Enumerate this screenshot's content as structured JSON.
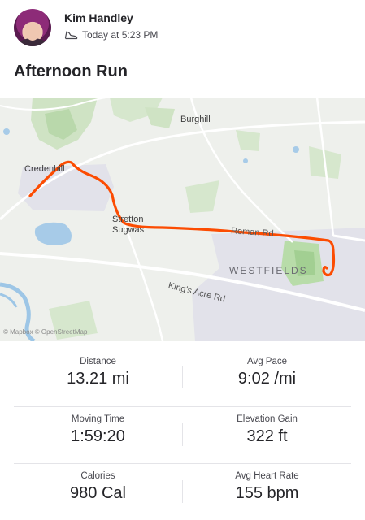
{
  "athlete": {
    "name": "Kim Handley",
    "timestamp": "Today at 5:23 PM",
    "activity_icon": "shoe-icon"
  },
  "activity": {
    "title": "Afternoon Run"
  },
  "map": {
    "labels": {
      "burghill": "Burghill",
      "credenhill": "Credenhill",
      "stretton_sugwas_1": "Stretton",
      "stretton_sugwas_2": "Sugwas",
      "westfields": "WESTFIELDS",
      "kings_acre_rd": "King's Acre Rd",
      "roman_rd": "Roman Rd"
    },
    "attribution": "© Mapbox © OpenStreetMap",
    "route_color": "#fc4c02"
  },
  "stats": {
    "distance": {
      "label": "Distance",
      "value": "13.21 mi"
    },
    "avg_pace": {
      "label": "Avg Pace",
      "value": "9:02 /mi"
    },
    "moving_time": {
      "label": "Moving Time",
      "value": "1:59:20"
    },
    "elevation_gain": {
      "label": "Elevation Gain",
      "value": "322 ft"
    },
    "calories": {
      "label": "Calories",
      "value": "980 Cal"
    },
    "avg_heart_rate": {
      "label": "Avg Heart Rate",
      "value": "155 bpm"
    }
  }
}
